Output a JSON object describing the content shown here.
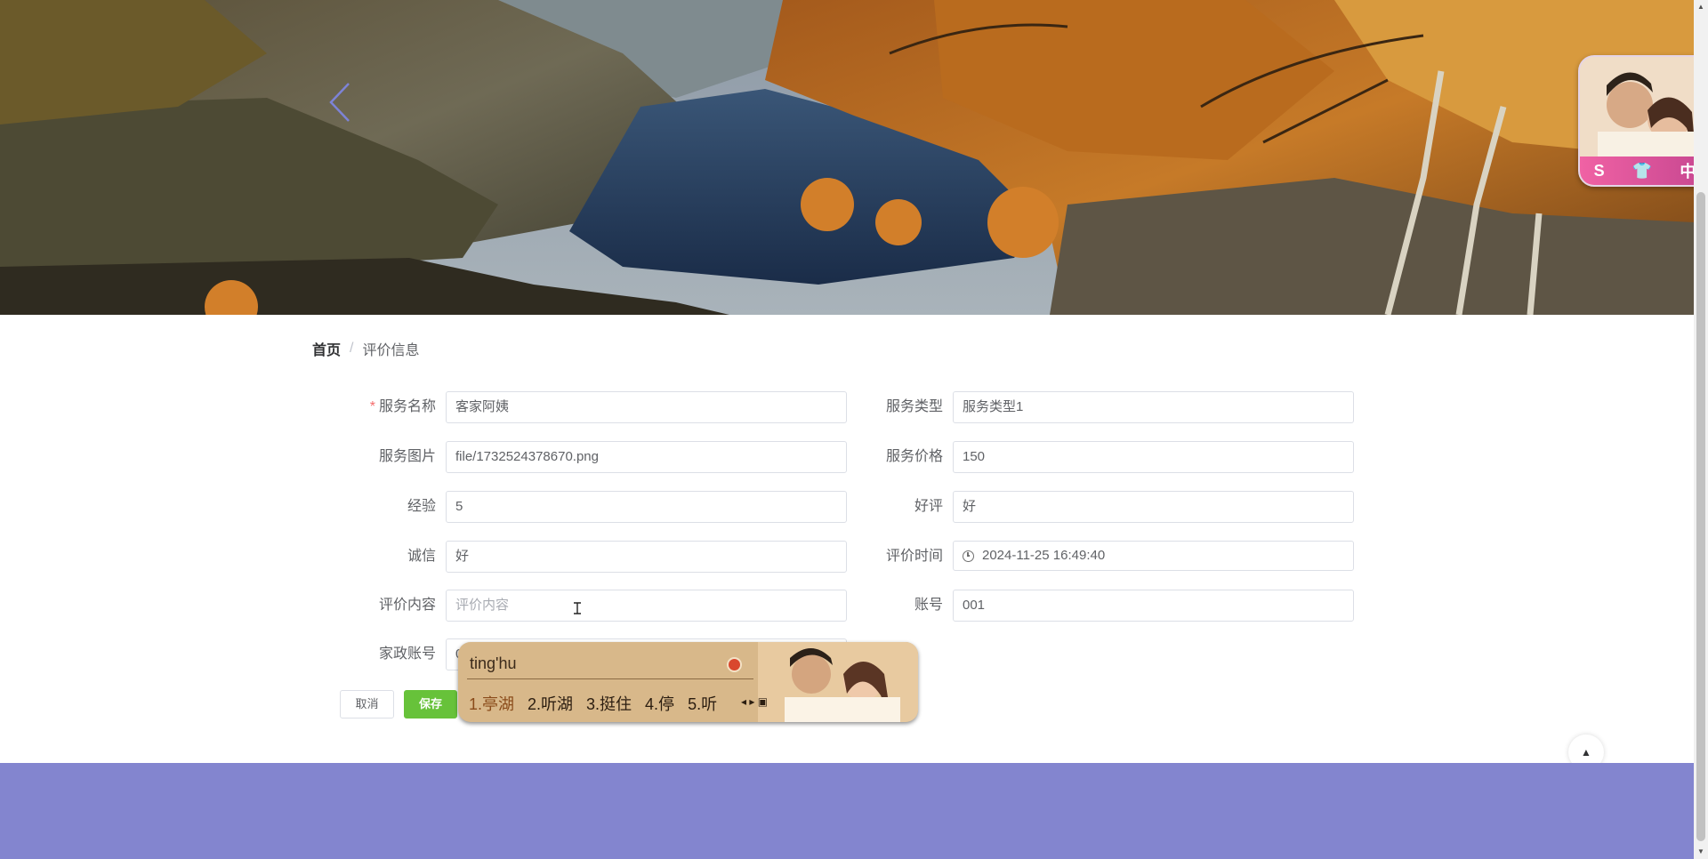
{
  "breadcrumb": {
    "home": "首页",
    "separator": "/",
    "current": "评价信息"
  },
  "form": {
    "service_name": {
      "label": "服务名称",
      "required_mark": "*",
      "value": "客家阿姨"
    },
    "service_type": {
      "label": "服务类型",
      "value": "服务类型1"
    },
    "service_image": {
      "label": "服务图片",
      "value": "file/1732524378670.png"
    },
    "service_price": {
      "label": "服务价格",
      "value": "150"
    },
    "experience": {
      "label": "经验",
      "value": "5"
    },
    "good_review": {
      "label": "好评",
      "value": "好"
    },
    "integrity": {
      "label": "诚信",
      "value": "好"
    },
    "review_time": {
      "label": "评价时间",
      "value": "2024-11-25 16:49:40"
    },
    "review_content": {
      "label": "评价内容",
      "placeholder": "评价内容"
    },
    "account": {
      "label": "账号",
      "value": "001"
    },
    "housekeeping_account": {
      "label": "家政账号",
      "value": "0"
    }
  },
  "buttons": {
    "cancel": "取消",
    "save": "保存"
  },
  "ime": {
    "composition": "ting'hu",
    "candidates": [
      "1.亭湖",
      "2.听湖",
      "3.挺住",
      "4.停",
      "5.听"
    ]
  },
  "floating_widget": {
    "icons": [
      "S",
      "👕",
      "中"
    ]
  },
  "colors": {
    "footer": "#8385cf",
    "save": "#67c23a",
    "required": "#f56c6c"
  }
}
